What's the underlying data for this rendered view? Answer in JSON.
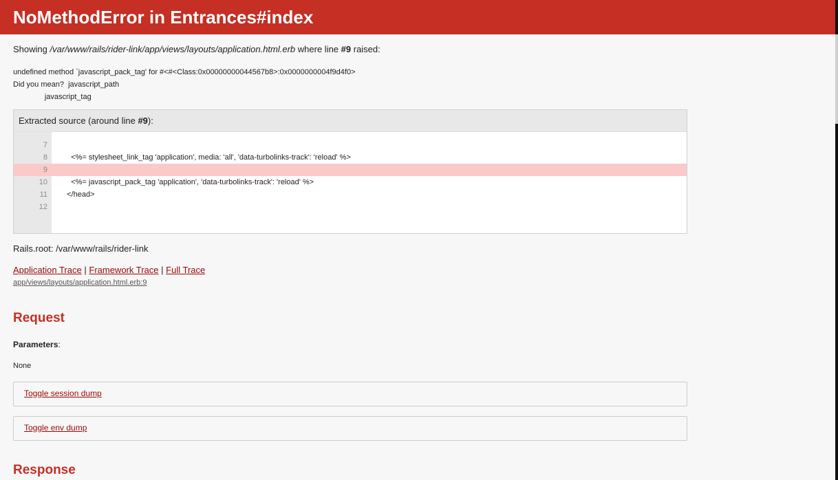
{
  "header": {
    "title": "NoMethodError in Entrances#index"
  },
  "error": {
    "showing_prefix": "Showing ",
    "template_path": "/var/www/rails/rider-link/app/views/layouts/application.html.erb",
    "showing_middle": " where line ",
    "line_ref": "#9",
    "showing_suffix": " raised:",
    "message": "undefined method `javascript_pack_tag' for #<#<Class:0x00000000044567b8>:0x0000000004f9d4f0>\nDid you mean?  javascript_path\n               javascript_tag"
  },
  "source": {
    "header_prefix": "Extracted source (around line ",
    "header_line": "#9",
    "header_suffix": "):",
    "lines": [
      {
        "num": "7",
        "text": ""
      },
      {
        "num": "8",
        "text": "    <%= stylesheet_link_tag 'application', media: 'all', 'data-turbolinks-track': 'reload' %>"
      },
      {
        "num": "9",
        "text": ""
      },
      {
        "num": "10",
        "text": "    <%= javascript_pack_tag 'application', 'data-turbolinks-track': 'reload' %>"
      },
      {
        "num": "11",
        "text": "  </head>"
      },
      {
        "num": "12",
        "text": ""
      }
    ],
    "highlight_line": "9"
  },
  "rails_root": "Rails.root: /var/www/rails/rider-link",
  "traces": {
    "application": "Application Trace",
    "separator": "|",
    "framework": "Framework Trace",
    "full": "Full Trace",
    "current": "app/views/layouts/application.html.erb:9"
  },
  "request": {
    "heading": "Request",
    "params_label": "Parameters",
    "params_colon": ":",
    "params_value": "None",
    "toggle_session": "Toggle session dump",
    "toggle_env": "Toggle env dump"
  },
  "response": {
    "heading": "Response"
  },
  "colors": {
    "accent": "#c52f24",
    "link": "#980905",
    "highlight": "#fcc9c9",
    "background": "#f7f7f7"
  }
}
